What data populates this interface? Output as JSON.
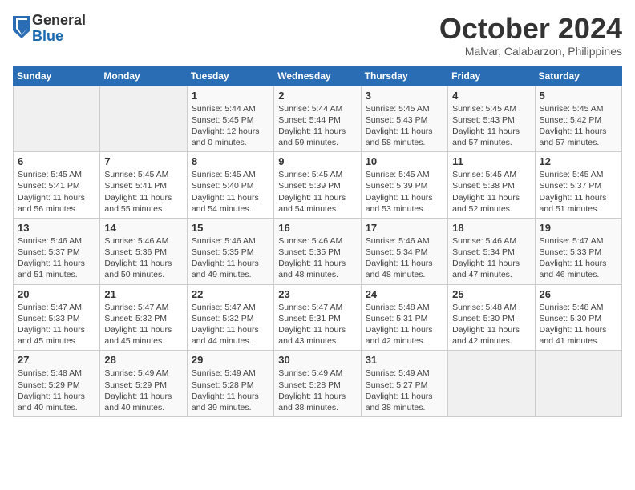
{
  "header": {
    "logo_general": "General",
    "logo_blue": "Blue",
    "month": "October 2024",
    "location": "Malvar, Calabarzon, Philippines"
  },
  "weekdays": [
    "Sunday",
    "Monday",
    "Tuesday",
    "Wednesday",
    "Thursday",
    "Friday",
    "Saturday"
  ],
  "weeks": [
    [
      {
        "day": "",
        "sunrise": "",
        "sunset": "",
        "daylight": "",
        "empty": true
      },
      {
        "day": "",
        "sunrise": "",
        "sunset": "",
        "daylight": "",
        "empty": true
      },
      {
        "day": "1",
        "sunrise": "Sunrise: 5:44 AM",
        "sunset": "Sunset: 5:45 PM",
        "daylight": "Daylight: 12 hours and 0 minutes.",
        "empty": false
      },
      {
        "day": "2",
        "sunrise": "Sunrise: 5:44 AM",
        "sunset": "Sunset: 5:44 PM",
        "daylight": "Daylight: 11 hours and 59 minutes.",
        "empty": false
      },
      {
        "day": "3",
        "sunrise": "Sunrise: 5:45 AM",
        "sunset": "Sunset: 5:43 PM",
        "daylight": "Daylight: 11 hours and 58 minutes.",
        "empty": false
      },
      {
        "day": "4",
        "sunrise": "Sunrise: 5:45 AM",
        "sunset": "Sunset: 5:43 PM",
        "daylight": "Daylight: 11 hours and 57 minutes.",
        "empty": false
      },
      {
        "day": "5",
        "sunrise": "Sunrise: 5:45 AM",
        "sunset": "Sunset: 5:42 PM",
        "daylight": "Daylight: 11 hours and 57 minutes.",
        "empty": false
      }
    ],
    [
      {
        "day": "6",
        "sunrise": "Sunrise: 5:45 AM",
        "sunset": "Sunset: 5:41 PM",
        "daylight": "Daylight: 11 hours and 56 minutes.",
        "empty": false
      },
      {
        "day": "7",
        "sunrise": "Sunrise: 5:45 AM",
        "sunset": "Sunset: 5:41 PM",
        "daylight": "Daylight: 11 hours and 55 minutes.",
        "empty": false
      },
      {
        "day": "8",
        "sunrise": "Sunrise: 5:45 AM",
        "sunset": "Sunset: 5:40 PM",
        "daylight": "Daylight: 11 hours and 54 minutes.",
        "empty": false
      },
      {
        "day": "9",
        "sunrise": "Sunrise: 5:45 AM",
        "sunset": "Sunset: 5:39 PM",
        "daylight": "Daylight: 11 hours and 54 minutes.",
        "empty": false
      },
      {
        "day": "10",
        "sunrise": "Sunrise: 5:45 AM",
        "sunset": "Sunset: 5:39 PM",
        "daylight": "Daylight: 11 hours and 53 minutes.",
        "empty": false
      },
      {
        "day": "11",
        "sunrise": "Sunrise: 5:45 AM",
        "sunset": "Sunset: 5:38 PM",
        "daylight": "Daylight: 11 hours and 52 minutes.",
        "empty": false
      },
      {
        "day": "12",
        "sunrise": "Sunrise: 5:45 AM",
        "sunset": "Sunset: 5:37 PM",
        "daylight": "Daylight: 11 hours and 51 minutes.",
        "empty": false
      }
    ],
    [
      {
        "day": "13",
        "sunrise": "Sunrise: 5:46 AM",
        "sunset": "Sunset: 5:37 PM",
        "daylight": "Daylight: 11 hours and 51 minutes.",
        "empty": false
      },
      {
        "day": "14",
        "sunrise": "Sunrise: 5:46 AM",
        "sunset": "Sunset: 5:36 PM",
        "daylight": "Daylight: 11 hours and 50 minutes.",
        "empty": false
      },
      {
        "day": "15",
        "sunrise": "Sunrise: 5:46 AM",
        "sunset": "Sunset: 5:35 PM",
        "daylight": "Daylight: 11 hours and 49 minutes.",
        "empty": false
      },
      {
        "day": "16",
        "sunrise": "Sunrise: 5:46 AM",
        "sunset": "Sunset: 5:35 PM",
        "daylight": "Daylight: 11 hours and 48 minutes.",
        "empty": false
      },
      {
        "day": "17",
        "sunrise": "Sunrise: 5:46 AM",
        "sunset": "Sunset: 5:34 PM",
        "daylight": "Daylight: 11 hours and 48 minutes.",
        "empty": false
      },
      {
        "day": "18",
        "sunrise": "Sunrise: 5:46 AM",
        "sunset": "Sunset: 5:34 PM",
        "daylight": "Daylight: 11 hours and 47 minutes.",
        "empty": false
      },
      {
        "day": "19",
        "sunrise": "Sunrise: 5:47 AM",
        "sunset": "Sunset: 5:33 PM",
        "daylight": "Daylight: 11 hours and 46 minutes.",
        "empty": false
      }
    ],
    [
      {
        "day": "20",
        "sunrise": "Sunrise: 5:47 AM",
        "sunset": "Sunset: 5:33 PM",
        "daylight": "Daylight: 11 hours and 45 minutes.",
        "empty": false
      },
      {
        "day": "21",
        "sunrise": "Sunrise: 5:47 AM",
        "sunset": "Sunset: 5:32 PM",
        "daylight": "Daylight: 11 hours and 45 minutes.",
        "empty": false
      },
      {
        "day": "22",
        "sunrise": "Sunrise: 5:47 AM",
        "sunset": "Sunset: 5:32 PM",
        "daylight": "Daylight: 11 hours and 44 minutes.",
        "empty": false
      },
      {
        "day": "23",
        "sunrise": "Sunrise: 5:47 AM",
        "sunset": "Sunset: 5:31 PM",
        "daylight": "Daylight: 11 hours and 43 minutes.",
        "empty": false
      },
      {
        "day": "24",
        "sunrise": "Sunrise: 5:48 AM",
        "sunset": "Sunset: 5:31 PM",
        "daylight": "Daylight: 11 hours and 42 minutes.",
        "empty": false
      },
      {
        "day": "25",
        "sunrise": "Sunrise: 5:48 AM",
        "sunset": "Sunset: 5:30 PM",
        "daylight": "Daylight: 11 hours and 42 minutes.",
        "empty": false
      },
      {
        "day": "26",
        "sunrise": "Sunrise: 5:48 AM",
        "sunset": "Sunset: 5:30 PM",
        "daylight": "Daylight: 11 hours and 41 minutes.",
        "empty": false
      }
    ],
    [
      {
        "day": "27",
        "sunrise": "Sunrise: 5:48 AM",
        "sunset": "Sunset: 5:29 PM",
        "daylight": "Daylight: 11 hours and 40 minutes.",
        "empty": false
      },
      {
        "day": "28",
        "sunrise": "Sunrise: 5:49 AM",
        "sunset": "Sunset: 5:29 PM",
        "daylight": "Daylight: 11 hours and 40 minutes.",
        "empty": false
      },
      {
        "day": "29",
        "sunrise": "Sunrise: 5:49 AM",
        "sunset": "Sunset: 5:28 PM",
        "daylight": "Daylight: 11 hours and 39 minutes.",
        "empty": false
      },
      {
        "day": "30",
        "sunrise": "Sunrise: 5:49 AM",
        "sunset": "Sunset: 5:28 PM",
        "daylight": "Daylight: 11 hours and 38 minutes.",
        "empty": false
      },
      {
        "day": "31",
        "sunrise": "Sunrise: 5:49 AM",
        "sunset": "Sunset: 5:27 PM",
        "daylight": "Daylight: 11 hours and 38 minutes.",
        "empty": false
      },
      {
        "day": "",
        "sunrise": "",
        "sunset": "",
        "daylight": "",
        "empty": true
      },
      {
        "day": "",
        "sunrise": "",
        "sunset": "",
        "daylight": "",
        "empty": true
      }
    ]
  ]
}
